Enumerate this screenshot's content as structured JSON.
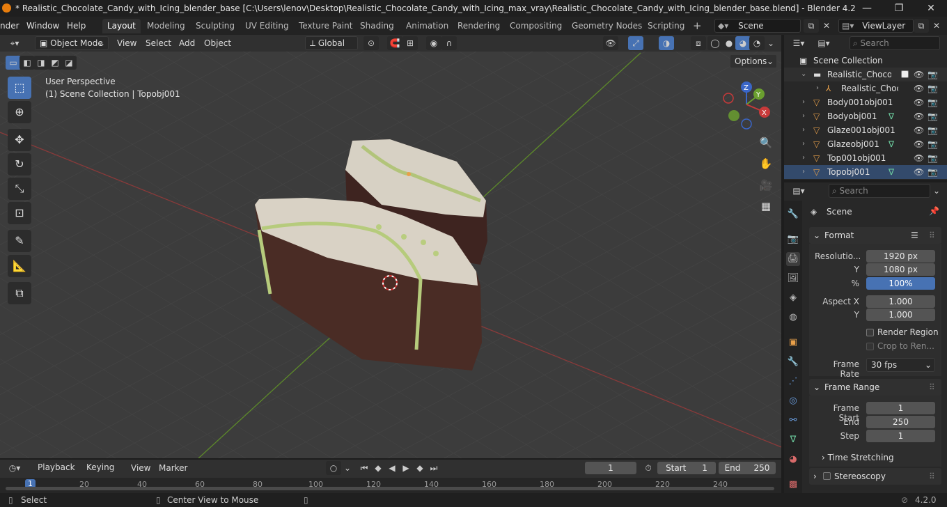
{
  "window": {
    "title": "* Realistic_Chocolate_Candy_with_Icing_blender_base [C:\\Users\\lenov\\Desktop\\Realistic_Chocolate_Candy_with_Icing_max_vray\\Realistic_Chocolate_Candy_with_Icing_blender_base.blend] - Blender 4.2",
    "minimize": "—",
    "maximize": "❐",
    "close": "✕"
  },
  "menus": [
    "nder",
    "Window",
    "Help"
  ],
  "workspaces": [
    "Layout",
    "Modeling",
    "Sculpting",
    "UV Editing",
    "Texture Paint",
    "Shading",
    "Animation",
    "Rendering",
    "Compositing",
    "Geometry Nodes",
    "Scripting"
  ],
  "scene_name": "Scene",
  "view_layer": "ViewLayer",
  "viewport": {
    "mode": "Object Mode",
    "menu": [
      "View",
      "Select",
      "Add",
      "Object"
    ],
    "transform_orientation": "Global",
    "options_label": "Options",
    "info_line1": "User Perspective",
    "info_line2": "(1) Scene Collection | Topobj001",
    "gizmo_z": "Z",
    "gizmo_y": "Y",
    "gizmo_x": "X"
  },
  "outliner": {
    "search_placeholder": "Search",
    "root": "Scene Collection",
    "rows": [
      {
        "label": "Realistic_Chocolate",
        "indent": 1
      },
      {
        "label": "Realistic_Choco",
        "indent": 2
      },
      {
        "label": "Body001obj001",
        "indent": 1
      },
      {
        "label": "Bodyobj001",
        "indent": 1
      },
      {
        "label": "Glaze001obj001",
        "indent": 1
      },
      {
        "label": "Glazeobj001",
        "indent": 1
      },
      {
        "label": "Top001obj001",
        "indent": 1
      },
      {
        "label": "Topobj001",
        "indent": 1
      }
    ]
  },
  "properties": {
    "search_placeholder": "Search",
    "context": "Scene",
    "format_panel": "Format",
    "resolution_x_label": "Resolutio...",
    "resolution_x": "1920 px",
    "resolution_y_label": "Y",
    "resolution_y": "1080 px",
    "percent_label": "%",
    "percent": "100%",
    "aspect_x_label": "Aspect X",
    "aspect_x": "1.000",
    "aspect_y_label": "Y",
    "aspect_y": "1.000",
    "render_region": "Render Region",
    "crop": "Crop to Ren...",
    "frame_rate_label": "Frame Rate",
    "frame_rate": "30 fps",
    "frame_range_panel": "Frame Range",
    "frame_start_label": "Frame Start",
    "frame_start": "1",
    "end_label": "End",
    "end": "250",
    "step_label": "Step",
    "step": "1",
    "time_stretching": "Time Stretching",
    "stereoscopy": "Stereoscopy"
  },
  "timeline": {
    "menus": [
      "Playback",
      "Keying",
      "View",
      "Marker"
    ],
    "current_frame": "1",
    "start_label": "Start",
    "start": "1",
    "end_label": "End",
    "end": "250",
    "ticks": [
      "1",
      "20",
      "40",
      "60",
      "80",
      "100",
      "120",
      "140",
      "160",
      "180",
      "200",
      "220",
      "240"
    ]
  },
  "status": {
    "select": "Select",
    "center": "Center View to Mouse",
    "version": "4.2.0"
  }
}
